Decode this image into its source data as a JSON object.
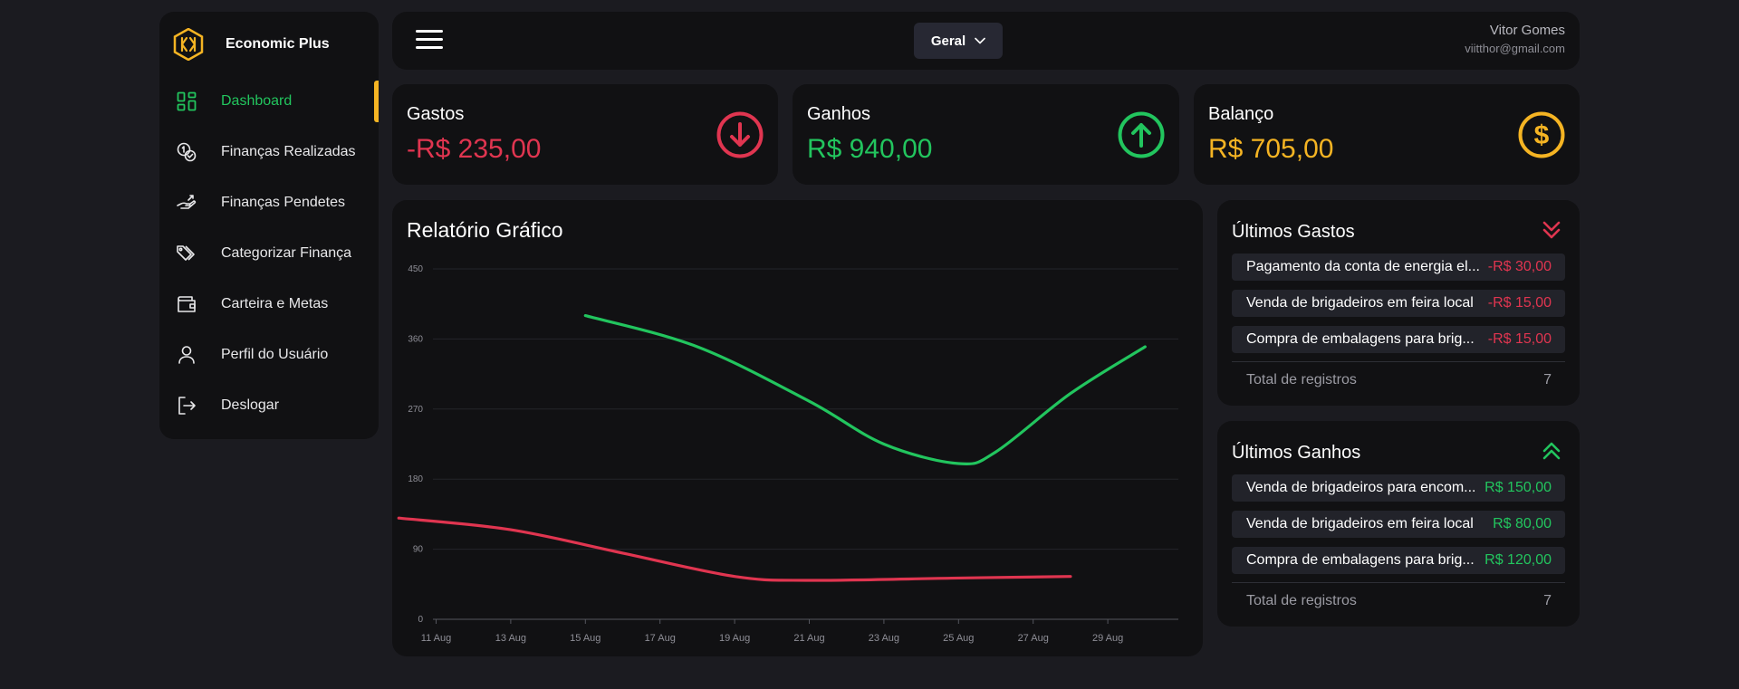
{
  "app": {
    "name": "Economic Plus"
  },
  "sidebar": {
    "items": [
      {
        "label": "Dashboard",
        "icon": "dashboard-icon",
        "active": true
      },
      {
        "label": "Finanças Realizadas",
        "icon": "coins-icon"
      },
      {
        "label": "Finanças Pendetes",
        "icon": "hand-money-icon"
      },
      {
        "label": "Categorizar Finança",
        "icon": "tags-icon"
      },
      {
        "label": "Carteira e Metas",
        "icon": "wallet-icon"
      },
      {
        "label": "Perfil do Usuário",
        "icon": "user-icon"
      },
      {
        "label": "Deslogar",
        "icon": "logout-icon"
      }
    ]
  },
  "topbar": {
    "filter_value": "Geral",
    "user_name": "Vitor Gomes",
    "user_email": "viitthor@gmail.com"
  },
  "cards": {
    "gastos": {
      "title": "Gastos",
      "value": "-R$ 235,00",
      "color": "#e03550"
    },
    "ganhos": {
      "title": "Ganhos",
      "value": "R$ 940,00",
      "color": "#22c55e"
    },
    "balanco": {
      "title": "Balanço",
      "value": "R$ 705,00",
      "color": "#f5b423"
    }
  },
  "chart": {
    "title": "Relatório Gráfico"
  },
  "chart_data": {
    "type": "line",
    "title": "Relatório Gráfico",
    "x_ticks": [
      "11 Aug",
      "13 Aug",
      "15 Aug",
      "17 Aug",
      "19 Aug",
      "21 Aug",
      "23 Aug",
      "25 Aug",
      "27 Aug",
      "29 Aug"
    ],
    "ylim": [
      0,
      450
    ],
    "y_ticks": [
      0,
      90,
      180,
      270,
      360,
      450
    ],
    "grid": true,
    "series": [
      {
        "color": "#22c55e",
        "points": [
          [
            "15 Aug",
            390
          ],
          [
            "18 Aug",
            350
          ],
          [
            "21 Aug",
            280
          ],
          [
            "23 Aug",
            225
          ],
          [
            "25 Aug",
            200
          ],
          [
            "26 Aug",
            215
          ],
          [
            "28 Aug",
            290
          ],
          [
            "30 Aug",
            350
          ]
        ]
      },
      {
        "color": "#e03550",
        "points": [
          [
            "10 Aug",
            130
          ],
          [
            "13 Aug",
            115
          ],
          [
            "16 Aug",
            85
          ],
          [
            "19 Aug",
            55
          ],
          [
            "21 Aug",
            50
          ],
          [
            "25 Aug",
            53
          ],
          [
            "28 Aug",
            55
          ]
        ]
      }
    ]
  },
  "ultimos_gastos": {
    "title": "Últimos Gastos",
    "items": [
      {
        "desc": "Pagamento da conta de energia el...",
        "amount": "-R$ 30,00"
      },
      {
        "desc": "Venda de brigadeiros em feira local",
        "amount": "-R$ 15,00"
      },
      {
        "desc": "Compra de embalagens para brig...",
        "amount": "-R$ 15,00"
      }
    ],
    "total_label": "Total de registros",
    "total": "7"
  },
  "ultimos_ganhos": {
    "title": "Últimos Ganhos",
    "items": [
      {
        "desc": "Venda de brigadeiros para encom...",
        "amount": "R$ 150,00"
      },
      {
        "desc": "Venda de brigadeiros em feira local",
        "amount": "R$ 80,00"
      },
      {
        "desc": "Compra de embalagens para brig...",
        "amount": "R$ 120,00"
      }
    ],
    "total_label": "Total de registros",
    "total": "7"
  },
  "colors": {
    "red": "#e03550",
    "green": "#22c55e",
    "gold": "#f5b423",
    "accent_bar": "#f5b423"
  }
}
